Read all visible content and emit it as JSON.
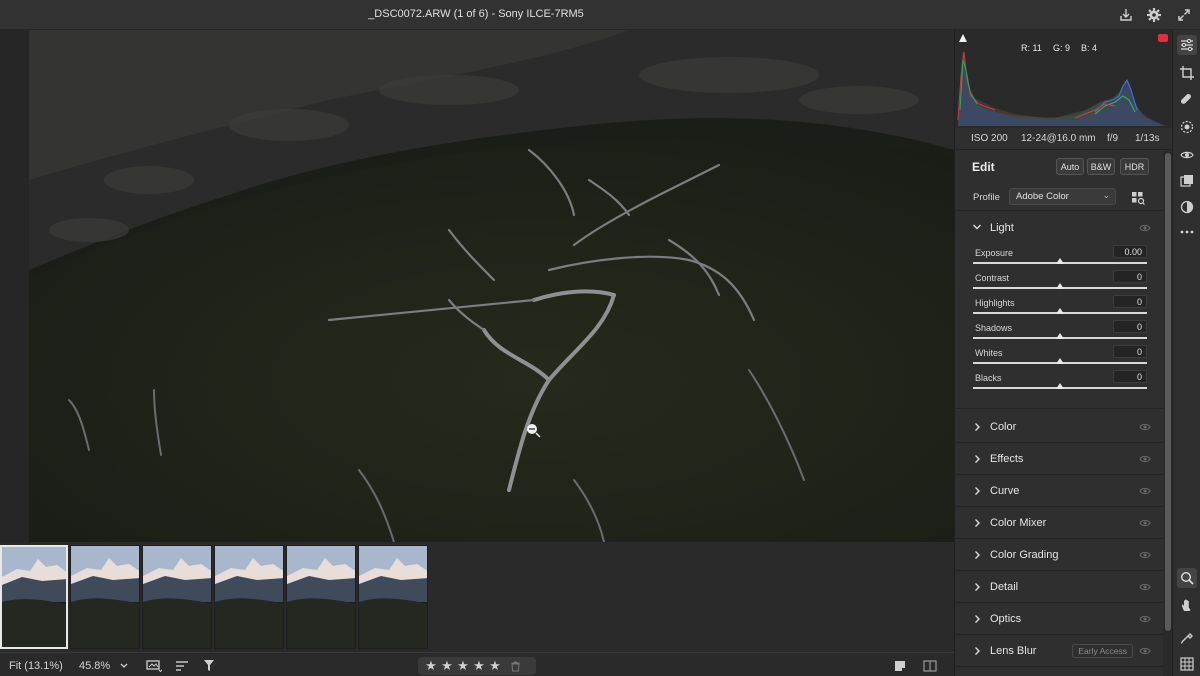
{
  "window": {
    "title": "_DSC0072.ARW (1 of 6)  -  Sony ILCE-7RM5"
  },
  "histogram": {
    "r_label": "R: 11",
    "g_label": "G: 9",
    "b_label": "B: 4"
  },
  "camera_info": {
    "iso": "ISO 200",
    "lens": "12-24@16.0 mm",
    "aperture": "f/9",
    "shutter": "1/13s"
  },
  "edit": {
    "title": "Edit",
    "auto_label": "Auto",
    "bw_label": "B&W",
    "hdr_label": "HDR"
  },
  "profile": {
    "label": "Profile",
    "value": "Adobe Color"
  },
  "light": {
    "title": "Light",
    "sliders": [
      {
        "label": "Exposure",
        "value": "0.00",
        "position": 0.5
      },
      {
        "label": "Contrast",
        "value": "0",
        "position": 0.5
      },
      {
        "label": "Highlights",
        "value": "0",
        "position": 0.5
      },
      {
        "label": "Shadows",
        "value": "0",
        "position": 0.5
      },
      {
        "label": "Whites",
        "value": "0",
        "position": 0.5
      },
      {
        "label": "Blacks",
        "value": "0",
        "position": 0.5
      }
    ]
  },
  "sections": [
    {
      "name": "Color"
    },
    {
      "name": "Effects"
    },
    {
      "name": "Curve"
    },
    {
      "name": "Color Mixer"
    },
    {
      "name": "Color Grading"
    },
    {
      "name": "Detail"
    },
    {
      "name": "Optics"
    },
    {
      "name": "Lens Blur",
      "badge": "Early Access"
    }
  ],
  "bottombar": {
    "fit_label": "Fit (13.1%)",
    "zoom_label": "45.8%",
    "rating_stars": 5
  },
  "filmstrip": {
    "count": 6,
    "selected_index": 0
  },
  "colors": {
    "background": "#2b2b2b",
    "panel": "#2f2f2f",
    "accent_warning": "#e0303a"
  }
}
